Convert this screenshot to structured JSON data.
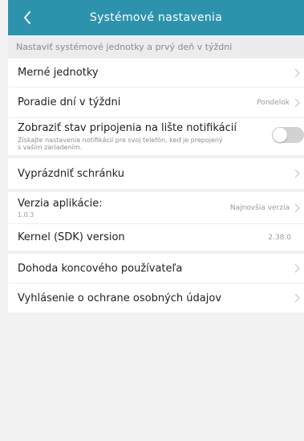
{
  "header": {
    "title": "Systémové nastavenia",
    "back_icon": "chevron-left-icon",
    "background": "#2d93ad"
  },
  "section_caption": "Nastaviť systémové jednotky a prvý deň v týždni",
  "rows": {
    "units": {
      "label": "Merné jednotky"
    },
    "week_order": {
      "label": "Poradie dní v týždni",
      "value": "Pondelok"
    },
    "notification_status": {
      "label": "Zobraziť stav pripojenia na lište notifikácií",
      "sub_line1": "Získajte nastavenia notifikácií pre svoj telefón, keď je prepojený",
      "sub_line2": "s vaším zariadením.",
      "toggle_on": false
    },
    "clear_cache": {
      "label": "Vyprázdniť schránku"
    },
    "app_version": {
      "label": "Verzia aplikácie:",
      "version": "1.0.3",
      "value": "Najnovšia verzia"
    },
    "kernel": {
      "label": "Kernel (SDK) version",
      "value": "2.38.0"
    },
    "eula": {
      "label": "Dohoda koncového používateľa"
    },
    "privacy": {
      "label": "Vyhlásenie o ochrane osobných údajov"
    }
  }
}
